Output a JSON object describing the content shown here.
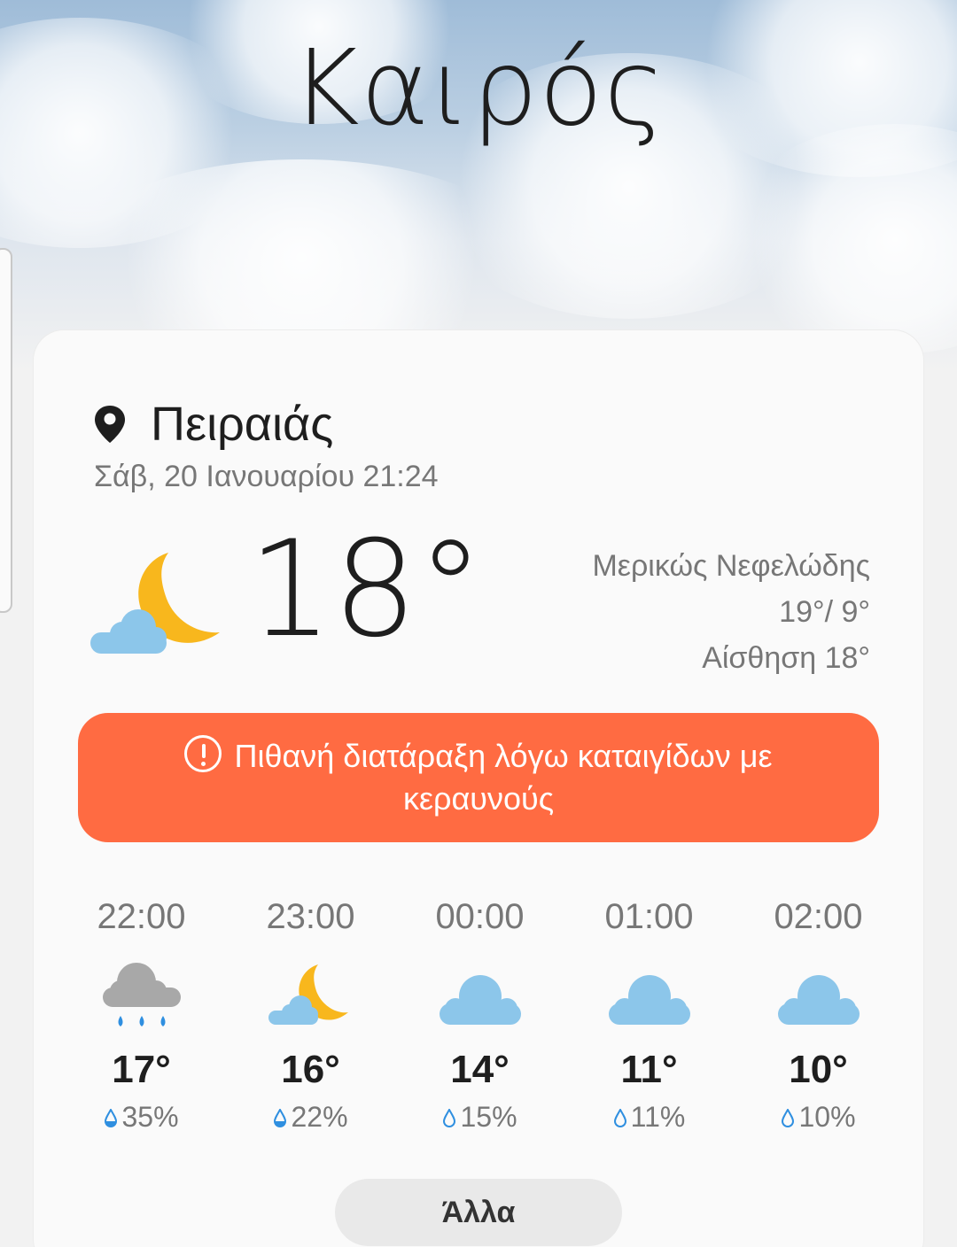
{
  "app": {
    "title": "Καιρός"
  },
  "location": {
    "city": "Πειραιάς",
    "datetime": "Σάβ, 20 Ιανουαρίου 21:24"
  },
  "current": {
    "temp": "18°",
    "condition": "Μερικώς Νεφελώδης",
    "high_low": "19°/ 9°",
    "feels_like": "Αίσθηση 18°",
    "icon": "moon-cloud-icon"
  },
  "alert": {
    "text": "Πιθανή διατάραξη λόγω καταιγίδων με κεραυνούς",
    "color": "#ff6b42"
  },
  "hourly": [
    {
      "time": "22:00",
      "temp": "17°",
      "precip": "35%",
      "icon": "rain-cloud-icon"
    },
    {
      "time": "23:00",
      "temp": "16°",
      "precip": "22%",
      "icon": "moon-cloud-icon"
    },
    {
      "time": "00:00",
      "temp": "14°",
      "precip": "15%",
      "icon": "cloud-icon"
    },
    {
      "time": "01:00",
      "temp": "11°",
      "precip": "11%",
      "icon": "cloud-icon"
    },
    {
      "time": "02:00",
      "temp": "10°",
      "precip": "10%",
      "icon": "cloud-icon"
    }
  ],
  "more_button": {
    "label": "Άλλα"
  }
}
